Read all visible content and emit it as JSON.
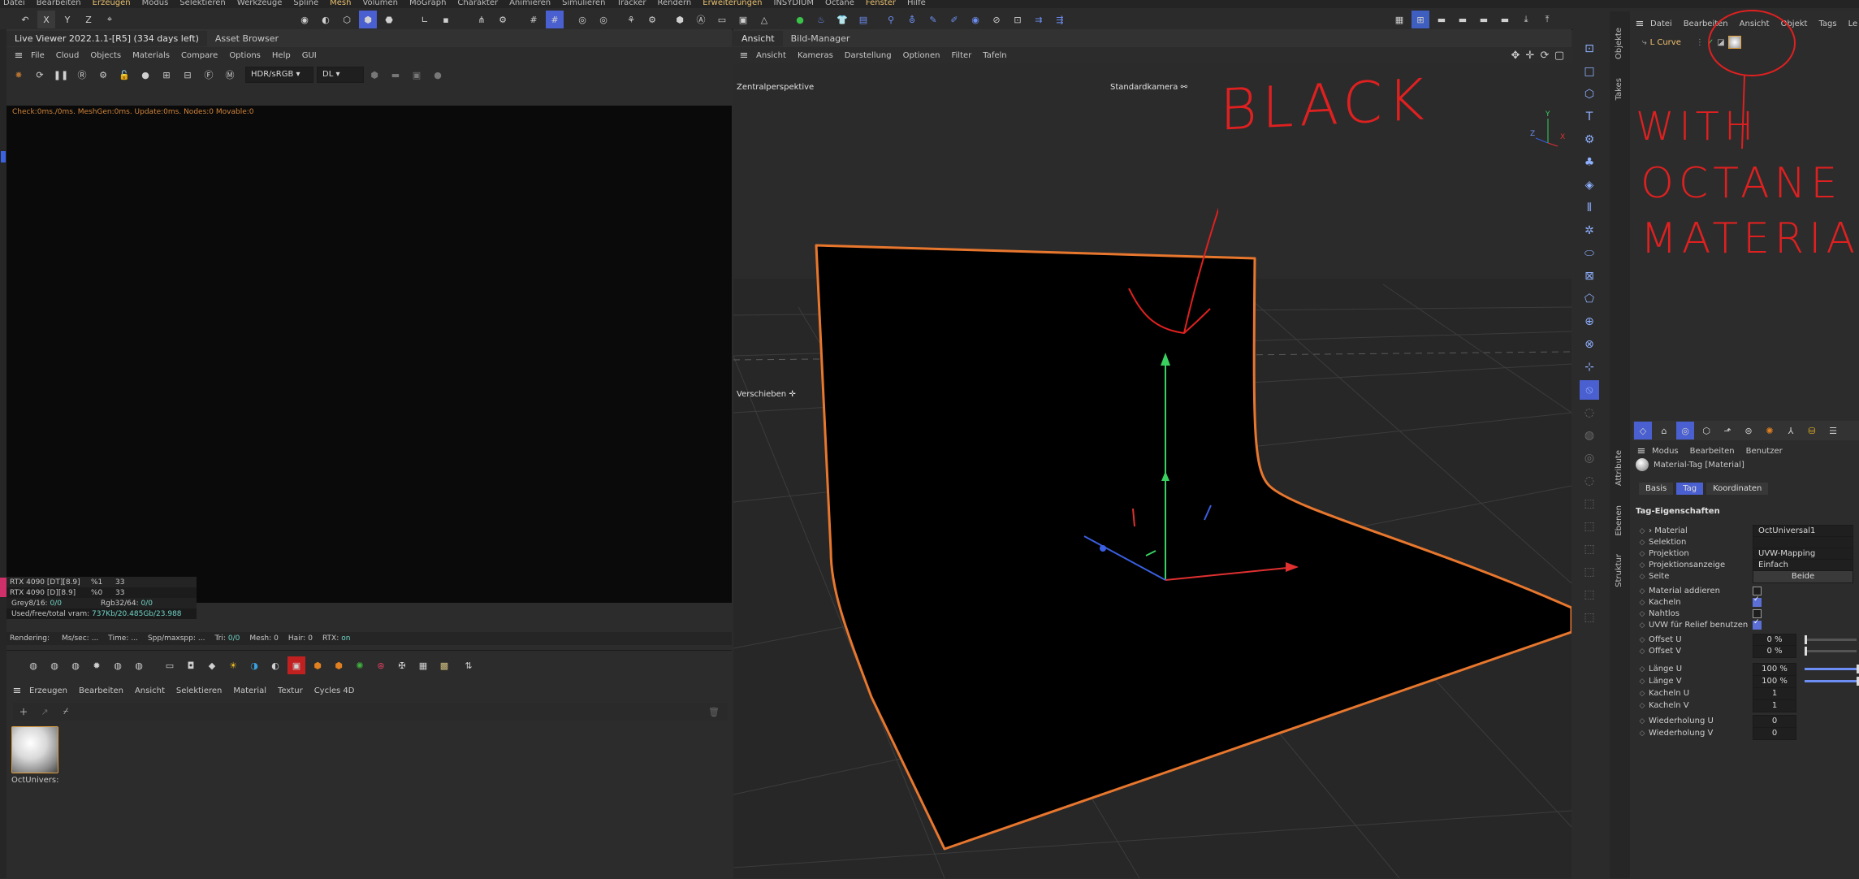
{
  "main_menu": [
    "Datei",
    "Bearbeiten",
    "Erzeugen",
    "Modus",
    "Selektieren",
    "Werkzeuge",
    "Spline",
    "Mesh",
    "Volumen",
    "MoGraph",
    "Charakter",
    "Animieren",
    "Simulieren",
    "Tracker",
    "Rendern",
    "Erweiterungen",
    "INSYDIUM",
    "Octane",
    "Fenster",
    "Hilfe"
  ],
  "main_menu_highlight": [
    "Erzeugen",
    "Mesh",
    "Erweiterungen",
    "Fenster"
  ],
  "axis_toggles": [
    "X",
    "Y",
    "Z"
  ],
  "live_viewer": {
    "title": "Live Viewer 2022.1.1-[R5] (334 days left)",
    "asset_tab": "Asset Browser",
    "menu": [
      "File",
      "Cloud",
      "Objects",
      "Materials",
      "Compare",
      "Options",
      "Help",
      "GUI"
    ],
    "color_mode": "HDR/sRGB",
    "kernel": "DL",
    "status_line": "Check:0ms./0ms. MeshGen:0ms. Update:0ms. Nodes:0 Movable:0",
    "gpu_table": [
      {
        "name": "RTX 4090 [DT][8.9]",
        "pct": "%1",
        "val": "33"
      },
      {
        "name": "RTX 4090 [D][8.9]",
        "pct": "%0",
        "val": "33"
      }
    ],
    "grey_label": "Grey8/16:",
    "grey_value": "0/0",
    "rgb_label": "Rgb32/64:",
    "rgb_value": "0/0",
    "vram_label": "Used/free/total vram:",
    "vram_value": "737Kb/20.485Gb/23.988",
    "render_stats": [
      {
        "label": "Rendering:",
        "value": ""
      },
      {
        "label": "Ms/sec:",
        "value": "..."
      },
      {
        "label": "Time:",
        "value": "..."
      },
      {
        "label": "Spp/maxspp:",
        "value": "..."
      },
      {
        "label": "Tri:",
        "value": "0/0"
      },
      {
        "label": "Mesh:",
        "value": "0"
      },
      {
        "label": "Hair:",
        "value": "0"
      },
      {
        "label": "RTX:",
        "value": "on"
      }
    ]
  },
  "material_manager": {
    "menu": [
      "Erzeugen",
      "Bearbeiten",
      "Ansicht",
      "Selektieren",
      "Material",
      "Textur",
      "Cycles 4D"
    ],
    "material_name": "OctUnivers:"
  },
  "viewport": {
    "tabs": [
      "Ansicht",
      "Bild-Manager"
    ],
    "menu": [
      "Ansicht",
      "Kameras",
      "Darstellung",
      "Optionen",
      "Filter",
      "Tafeln"
    ],
    "projection": "Zentralperspektive",
    "camera": "Standardkamera",
    "tool_label": "Verschieben",
    "axis_labels": [
      "Y",
      "Z",
      "X"
    ]
  },
  "object_manager": {
    "menu": [
      "Datei",
      "Bearbeiten",
      "Ansicht",
      "Objekt",
      "Tags",
      "Le"
    ],
    "object_name": "L Curve",
    "side_tabs": [
      "Objekte",
      "Takes"
    ]
  },
  "attributes": {
    "side_tabs": [
      "Attribute",
      "Ebenen",
      "Struktur"
    ],
    "menu": [
      "Modus",
      "Bearbeiten",
      "Benutzer"
    ],
    "header": "Material-Tag [Material]",
    "tabs": [
      "Basis",
      "Tag",
      "Koordinaten"
    ],
    "active_tab": "Tag",
    "section": "Tag-Eigenschaften",
    "props": [
      {
        "label": "Material",
        "value": "OctUniversal1",
        "kind": "field",
        "arrow": true
      },
      {
        "label": "Selektion",
        "value": "",
        "kind": "field"
      },
      {
        "label": "Projektion",
        "value": "UVW-Mapping",
        "kind": "field"
      },
      {
        "label": "Projektionsanzeige",
        "value": "Einfach",
        "kind": "field"
      },
      {
        "label": "Seite",
        "value": "Beide",
        "kind": "button"
      },
      {
        "label": "Material addieren",
        "value": "off",
        "kind": "check"
      },
      {
        "label": "Kacheln",
        "value": "on",
        "kind": "check"
      },
      {
        "label": "Nahtlos",
        "value": "off",
        "kind": "check"
      },
      {
        "label": "UVW für Relief benutzen",
        "value": "on",
        "kind": "check"
      },
      {
        "label": "Offset U",
        "value": "0 %",
        "kind": "slider",
        "fill": 0
      },
      {
        "label": "Offset V",
        "value": "0 %",
        "kind": "slider",
        "fill": 0
      },
      {
        "label": "Länge U",
        "value": "100 %",
        "kind": "slider",
        "fill": 1
      },
      {
        "label": "Länge V",
        "value": "100 %",
        "kind": "slider",
        "fill": 1
      },
      {
        "label": "Kacheln U",
        "value": "1",
        "kind": "field"
      },
      {
        "label": "Kacheln V",
        "value": "1",
        "kind": "field"
      },
      {
        "label": "Wiederholung U",
        "value": "0",
        "kind": "field"
      },
      {
        "label": "Wiederholung V",
        "value": "0",
        "kind": "field"
      }
    ]
  },
  "annotations": {
    "black": "BLACK",
    "with": "WITH",
    "octane": "OCTANE",
    "material": "MATERIAL",
    "color": "#e02020"
  },
  "colors": {
    "accent_orange": "#e8772e",
    "selected_blue": "#4a5fd0",
    "status_orange": "#d0843a",
    "vram_green": "#6fd2c5"
  }
}
